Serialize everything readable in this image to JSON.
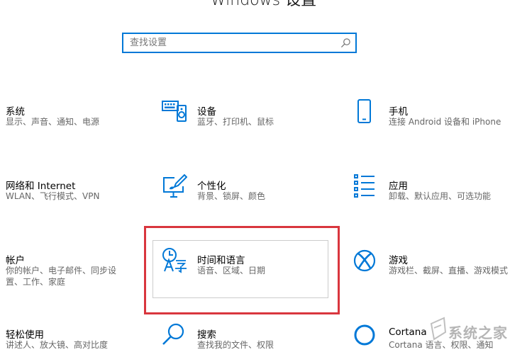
{
  "header": {
    "title": "Windows 设置"
  },
  "search": {
    "placeholder": "查找设置"
  },
  "tiles": [
    {
      "title": "系统",
      "desc": "显示、声音、通知、电源"
    },
    {
      "title": "设备",
      "desc": "蓝牙、打印机、鼠标"
    },
    {
      "title": "手机",
      "desc": "连接 Android 设备和 iPhone"
    },
    {
      "title": "网络和 Internet",
      "desc": "WLAN、飞行模式、VPN"
    },
    {
      "title": "个性化",
      "desc": "背景、锁屏、颜色"
    },
    {
      "title": "应用",
      "desc": "卸载、默认应用、可选功能"
    },
    {
      "title": "帐户",
      "desc": "你的帐户、电子邮件、同步设置、工作、家庭"
    },
    {
      "title": "时间和语言",
      "desc": "语音、区域、日期"
    },
    {
      "title": "游戏",
      "desc": "游戏栏、截屏、直播、游戏模式"
    },
    {
      "title": "轻松使用",
      "desc": "讲述人、放大镜、高对比度"
    },
    {
      "title": "搜索",
      "desc": "查找我的文件、权限"
    },
    {
      "title": "Cortana",
      "desc": "Cortana 语言、权限、通知"
    }
  ],
  "icons": {
    "devices": "keyboard-speaker-icon",
    "phone": "phone-icon",
    "personalization": "paint-monitor-icon",
    "apps": "app-list-icon",
    "time_language": "time-language-icon",
    "gaming": "xbox-icon",
    "search": "magnifier-icon",
    "cortana": "cortana-circle-icon"
  },
  "colors": {
    "accent": "#0078d7",
    "highlight": "#d9363e"
  },
  "watermark": {
    "text": "系统之家"
  }
}
